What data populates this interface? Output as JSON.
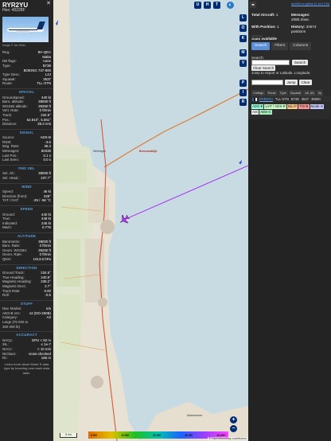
{
  "aircraft": {
    "reg": "RYR2YU",
    "hex_label": "Hex:",
    "hex": "40228F",
    "photo_credit": "Image © Jan Seler",
    "close_label": "✕"
  },
  "info_rows": [
    {
      "k": "Reg.:",
      "v": "9H-QEA"
    },
    {
      "k": "",
      "v": "Malta"
    },
    {
      "k": "DB flags:",
      "v": "none"
    },
    {
      "k": "Type:",
      "v": "B738"
    },
    {
      "k": "",
      "v": "BOEING 737-800"
    },
    {
      "k": "Type Desc.:",
      "v": "L2J"
    },
    {
      "k": "Squawk:",
      "v": "3537"
    },
    {
      "k": "Route:",
      "v": "TLL-STN"
    }
  ],
  "sections": [
    {
      "title": "SPATIAL",
      "rows": [
        {
          "k": "Groundspeed:",
          "v": "440 kt"
        },
        {
          "k": "Baro. altitude:",
          "v": "38000 ft"
        },
        {
          "k": "WGS84 altitude:",
          "v": "39250 ft"
        },
        {
          "k": "Vert. Rate:",
          "v": "0 ft/min"
        },
        {
          "k": "Track:",
          "v": "234.5°"
        },
        {
          "k": "Pos.:",
          "v": "52.810°, 5.061°"
        },
        {
          "k": "Distance:",
          "v": "38.3 nmi"
        }
      ]
    },
    {
      "title": "SIGNAL",
      "rows": [
        {
          "k": "Source:",
          "v": "ADS-B"
        },
        {
          "k": "RSSI:",
          "v": "-3.5"
        },
        {
          "k": "Msg. Rate:",
          "v": "36.3"
        },
        {
          "k": "Messages:",
          "v": "60338"
        },
        {
          "k": "Last Pos.:",
          "v": "0.1 s"
        },
        {
          "k": "Last Seen:",
          "v": "0.0 s"
        }
      ]
    },
    {
      "title": "FMS SEL",
      "rows": [
        {
          "k": "Sel. Alt.:",
          "v": "38000 ft"
        },
        {
          "k": "Sel. Head.:",
          "v": "237.7°"
        }
      ]
    },
    {
      "title": "WIND",
      "rows": [
        {
          "k": "Speed:",
          "v": "46 kt"
        },
        {
          "k": "Direction (from):",
          "v": "328°"
        },
        {
          "k": "TAT / OAT:",
          "v": "-29 / -56 °C"
        }
      ]
    },
    {
      "title": "SPEED",
      "rows": [
        {
          "k": "Ground:",
          "v": "440 kt"
        },
        {
          "k": "True:",
          "v": "448 kt"
        },
        {
          "k": "Indicated:",
          "v": "245 kt"
        },
        {
          "k": "Mach:",
          "v": "0.776"
        }
      ]
    },
    {
      "title": "ALTITUDE",
      "rows": [
        {
          "k": "Barometric:",
          "v": "38000 ft"
        },
        {
          "k": "Baro. Rate:",
          "v": "0 ft/min"
        },
        {
          "k": "Geom. WGS84:",
          "v": "39250 ft"
        },
        {
          "k": "Geom. Rate:",
          "v": "0 ft/min"
        },
        {
          "k": "QNH:",
          "v": "1013.6 hPa"
        }
      ]
    },
    {
      "title": "DIRECTION",
      "rows": [
        {
          "k": "Ground Track:",
          "v": "234.5°"
        },
        {
          "k": "True Heading:",
          "v": "240.6°"
        },
        {
          "k": "Magnetic Heading:",
          "v": "238.2°"
        },
        {
          "k": "Magnetic Decl.:",
          "v": "2.7°"
        },
        {
          "k": "Track Rate:",
          "v": "0.00"
        },
        {
          "k": "Roll:",
          "v": "-0.5"
        }
      ]
    },
    {
      "title": "STUFF",
      "rows": [
        {
          "k": "Nav. Modes:",
          "v": "n/a"
        },
        {
          "k": "ADS-B Ver.:",
          "v": "v2 (DO-260B)"
        },
        {
          "k": "Category:",
          "v": "A3"
        },
        {
          "k": "Large (75 000 to",
          "v": ""
        },
        {
          "k": "300 000 lb)",
          "v": ""
        }
      ]
    },
    {
      "title": "ACCURACY",
      "rows": [
        {
          "k": "NACp:",
          "v": "EPU < 92 m"
        },
        {
          "k": "SIL:",
          "v": "≤ 1e-7"
        },
        {
          "k": "NACv:",
          "v": "< 10 m/s"
        },
        {
          "k": "NICbaro:",
          "v": "cross-checked"
        },
        {
          "k": "Rc:",
          "v": "186 m"
        }
      ]
    }
  ],
  "footer_note": "Learn more about Mode S data type by hovering over each data label.",
  "map": {
    "top_buttons": [
      "U",
      "H",
      "T"
    ],
    "side_buttons": [
      "L",
      "O",
      "K",
      "M",
      "V",
      "P",
      "I",
      "R"
    ],
    "zoom_in": "+",
    "zoom_out": "−",
    "scale_label": "5 nm",
    "altitude_ticks": [
      "6 000",
      "10 000",
      "20 000",
      "30 000",
      "40 000+"
    ],
    "attribution": "© OpenStreetMap contributors",
    "towns": [
      {
        "name": "Wieringen",
        "red": false
      },
      {
        "name": "Breezanddijk",
        "red": true
      },
      {
        "name": "Markermeer",
        "red": false
      }
    ],
    "colors": {
      "track": "#a020f0",
      "plane": "#b030f0",
      "water": "#c9dbe2",
      "land": "#e8e2d4"
    }
  },
  "right": {
    "top_link": "tar1090 on github (3 Jul 1744)",
    "arrow": "◂▸",
    "stats": [
      {
        "label": "Total Aircraft:",
        "value": "1"
      },
      {
        "label": "Messages:",
        "value": "2080.2/sec"
      },
      {
        "label": "With Position:",
        "value": "1"
      },
      {
        "label": "History:",
        "value": "32574 positions"
      },
      {
        "label": "Stats available",
        "value": ""
      }
    ],
    "tabs": [
      "Search",
      "Filters",
      "Columns"
    ],
    "search_label": "Search:",
    "search_placeholder": "",
    "search_button": "Search",
    "clear_search_button": "Clear Search",
    "jump_label": "Jump to Airport or Latitude, Longitude:",
    "jump_button": "Jump",
    "clear_button": "Clear",
    "columns": [
      "Callsign",
      "Route",
      "Type",
      "Squawk",
      "Alt. (ft)",
      "Sp"
    ],
    "table_row": {
      "callsign": "RYR2YU",
      "route": "TLL-STN",
      "type": "B738",
      "squawk": "3537",
      "alt": "38000"
    },
    "legend": [
      {
        "label": "ADS-B",
        "color": "#9fd"
      },
      {
        "label": "UAT / ADS-R",
        "color": "#cfc"
      },
      {
        "label": "MLAT",
        "color": "#fc8"
      },
      {
        "label": "TIS-B",
        "color": "#f99"
      },
      {
        "label": "Mode-S",
        "color": "#ccf"
      },
      {
        "label": "AIS",
        "color": "#eee"
      },
      {
        "label": "ADS-C",
        "color": "#aeb"
      }
    ]
  }
}
